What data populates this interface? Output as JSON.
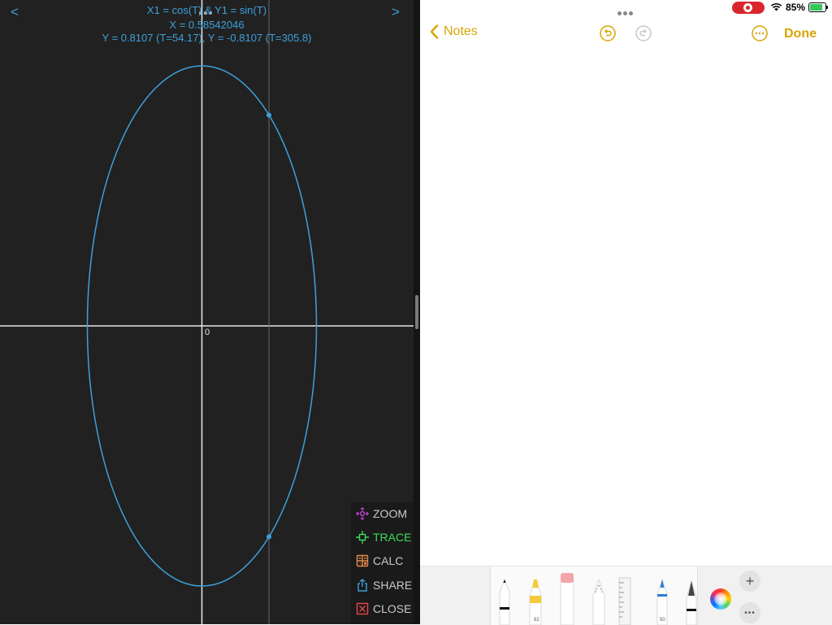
{
  "calculator": {
    "prev_label": "<",
    "next_label": ">",
    "equation": "X1 = cos(T) & Y1 = sin(T)",
    "x_readout": "X = 0.58542046",
    "y_readout": "Y = 0.8107 (T=54.17), Y = -0.8107 (T=305.8)",
    "origin_label": "0",
    "menu": [
      {
        "label": "ZOOM",
        "icon": "zoom-icon",
        "color": "#c040d0"
      },
      {
        "label": "TRACE",
        "icon": "trace-icon",
        "color": "#3ddc5c"
      },
      {
        "label": "CALC",
        "icon": "calc-icon",
        "color": "#e8894a"
      },
      {
        "label": "SHARE",
        "icon": "share-icon",
        "color": "#3da0dc"
      },
      {
        "label": "CLOSE",
        "icon": "close-icon",
        "color": "#e8484a"
      }
    ],
    "curve_color": "#3da0dc",
    "trace_x": 0.58542046,
    "trace_points_y": [
      0.8107,
      -0.8107
    ]
  },
  "status_bar": {
    "battery_pct": "85%",
    "battery_level": 0.85,
    "recording": true
  },
  "notes": {
    "back_label": "Notes",
    "done_label": "Done",
    "accent_color": "#d9a400"
  },
  "toolbar": {
    "tools": [
      {
        "name": "pen",
        "number": ""
      },
      {
        "name": "highlighter",
        "number": "82"
      },
      {
        "name": "eraser",
        "number": ""
      },
      {
        "name": "lasso",
        "number": ""
      },
      {
        "name": "ruler",
        "number": ""
      },
      {
        "name": "marker",
        "number": "50"
      },
      {
        "name": "fountain-pen",
        "number": ""
      }
    ],
    "add_label": "+",
    "more_label": "•••"
  }
}
